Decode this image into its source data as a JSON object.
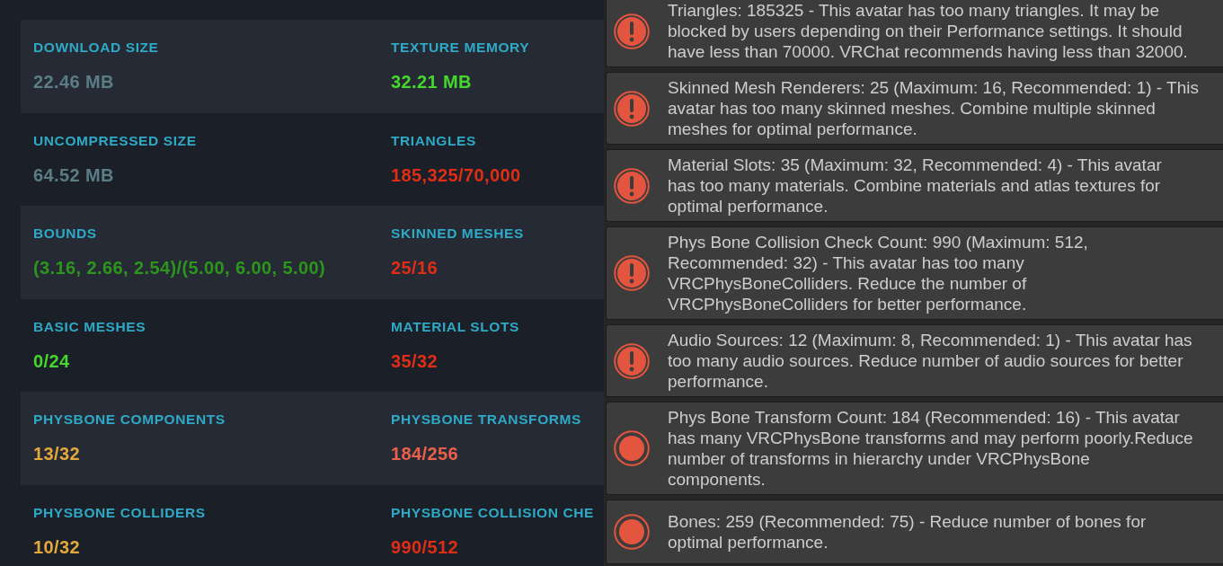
{
  "stat_rows": [
    {
      "cells": [
        {
          "label": "DOWNLOAD SIZE",
          "value": "22.46 MB",
          "color": "#5b7d86"
        },
        {
          "label": "TEXTURE MEMORY",
          "value": "32.21 MB",
          "color": "#45d82c"
        }
      ]
    },
    {
      "cells": [
        {
          "label": "UNCOMPRESSED SIZE",
          "value": "64.52 MB",
          "color": "#5b7d86"
        },
        {
          "label": "TRIANGLES",
          "value": "185,325/70,000",
          "color": "#e02d16"
        }
      ]
    },
    {
      "cells": [
        {
          "label": "BOUNDS",
          "value": "(3.16, 2.66, 2.54)/(5.00, 6.00, 5.00)",
          "color": "#2b961b"
        },
        {
          "label": "SKINNED MESHES",
          "value": "25/16",
          "color": "#e02d16"
        }
      ]
    },
    {
      "cells": [
        {
          "label": "BASIC MESHES",
          "value": "0/24",
          "color": "#45d82c"
        },
        {
          "label": "MATERIAL SLOTS",
          "value": "35/32",
          "color": "#e02d16"
        }
      ]
    },
    {
      "cells": [
        {
          "label": "PHYSBONE COMPONENTS",
          "value": "13/32",
          "color": "#e3a83a"
        },
        {
          "label": "PHYSBONE TRANSFORMS",
          "value": "184/256",
          "color": "#ea604b"
        }
      ]
    },
    {
      "cells": [
        {
          "label": "PHYSBONE COLLIDERS",
          "value": "10/32",
          "color": "#e3a83a"
        },
        {
          "label": "PHYSBONE COLLISION CHE",
          "value": "990/512",
          "color": "#e02d16"
        }
      ]
    }
  ],
  "messages": [
    {
      "kind": "error",
      "text": "Triangles: 185325 - This avatar has too many triangles. It may be\nblocked by users depending on their Performance settings. It should\nhave less than 70000. VRChat recommends having less than 32000."
    },
    {
      "kind": "error",
      "text": "Skinned Mesh Renderers: 25 (Maximum: 16, Recommended: 1) - This\navatar has too many skinned meshes. Combine multiple skinned\nmeshes for optimal performance."
    },
    {
      "kind": "error",
      "text": "Material Slots: 35 (Maximum: 32, Recommended: 4) - This avatar\nhas too many materials. Combine materials and atlas textures for\noptimal performance."
    },
    {
      "kind": "error",
      "text": "Phys Bone Collision Check Count: 990 (Maximum: 512,\nRecommended: 32) - This avatar has too many\nVRCPhysBoneColliders. Reduce the number of\nVRCPhysBoneColliders for better performance."
    },
    {
      "kind": "error",
      "text": "Audio Sources: 12 (Maximum: 8, Recommended: 1) - This avatar has\ntoo many audio sources. Reduce number of audio sources for better\nperformance."
    },
    {
      "kind": "warning",
      "text": "Phys Bone Transform Count: 184 (Recommended: 16) - This avatar\nhas many VRCPhysBone transforms and may perform poorly.Reduce\nnumber of transforms in hierarchy under VRCPhysBone\ncomponents."
    },
    {
      "kind": "warning",
      "text": "Bones: 259 (Recommended: 75) - Reduce number of bones for\noptimal performance."
    }
  ]
}
